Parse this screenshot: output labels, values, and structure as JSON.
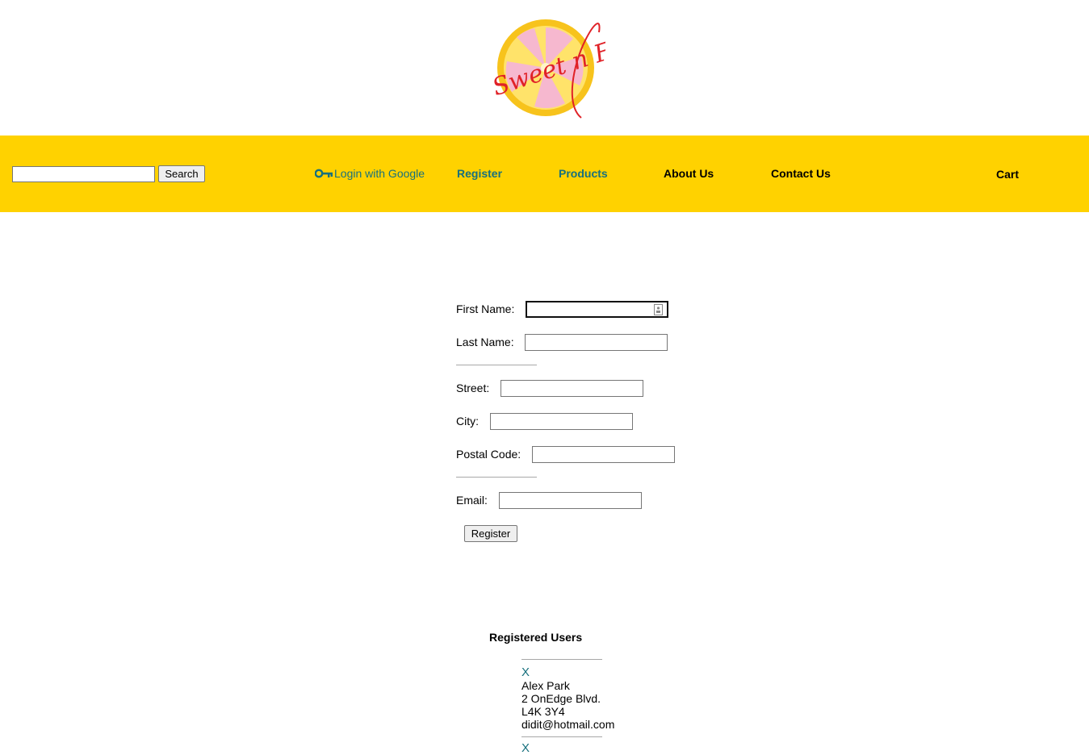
{
  "brand": {
    "logo_text": "Sweet n Fun"
  },
  "colors": {
    "accent": "#ffd200",
    "link": "#17707d"
  },
  "search": {
    "value": "",
    "button_label": "Search"
  },
  "nav": {
    "google_label": "Login with Google",
    "register": "Register",
    "products": "Products",
    "about": "About Us",
    "contact": "Contact Us",
    "cart": "Cart"
  },
  "form": {
    "first_name_label": "First Name:",
    "last_name_label": "Last Name:",
    "street_label": "Street:",
    "city_label": "City:",
    "postal_label": "Postal Code:",
    "email_label": "Email:",
    "first_name": "",
    "last_name": "",
    "street": "",
    "city": "",
    "postal": "",
    "email": "",
    "submit_label": "Register"
  },
  "users": {
    "title": "Registered Users",
    "items": [
      {
        "remove": "X",
        "name": "Alex Park",
        "street": "2 OnEdge Blvd.",
        "postal": "L4K 3Y4",
        "email": "didit@hotmail.com"
      },
      {
        "remove": "X"
      }
    ]
  }
}
